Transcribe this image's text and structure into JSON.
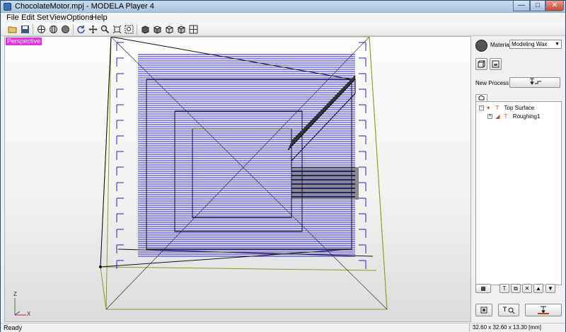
{
  "window": {
    "title": "ChocolateMotor.mpj - MODELA Player 4"
  },
  "window_controls": {
    "minimize": "—",
    "maximize": "□",
    "close": "✕"
  },
  "menu": {
    "items": [
      "File",
      "Edit",
      "Set",
      "View",
      "Options",
      "Help"
    ]
  },
  "toolbar": {
    "icons": [
      "open-file-icon",
      "save-icon",
      "view-mesh-icon",
      "view-globe-icon",
      "view-solid-icon",
      "rotate-icon",
      "pan-icon",
      "zoom-icon",
      "fit-icon",
      "zoom-window-icon",
      "view-front-icon",
      "view-top-icon",
      "view-right-icon",
      "view-iso-icon",
      "view-grid-icon"
    ]
  },
  "viewport": {
    "label": "Perspective",
    "label_color": "#e82ee8",
    "toolpath_color": "#2a1ed8",
    "wireframe_color": "#8f9a2a",
    "axis_z": "Z",
    "axis_x": "X"
  },
  "panel": {
    "material_label": "Material",
    "material_value": "Modeling Wax",
    "material_arrow": "▼",
    "new_process_label": "New Process",
    "new_process_icon": "tool-path-icon",
    "tab_icon": "cube-tab-icon",
    "tree": [
      {
        "expander": "−",
        "label": "Top Surface",
        "icon": "surface-icon"
      },
      {
        "expander": "+",
        "label": "Roughing1",
        "icon": "roughing-icon"
      }
    ],
    "action_icons": [
      "process-list-icon",
      "tool-icon",
      "copy-icon",
      "delete-icon",
      "move-up-icon",
      "move-down-icon"
    ],
    "bottom_icons": [
      "sheet-icon",
      "tool-search-icon",
      "cut-icon"
    ]
  },
  "status": {
    "left": "Ready",
    "right": "32.60 x 32.60 x 13.30 [mm]"
  }
}
